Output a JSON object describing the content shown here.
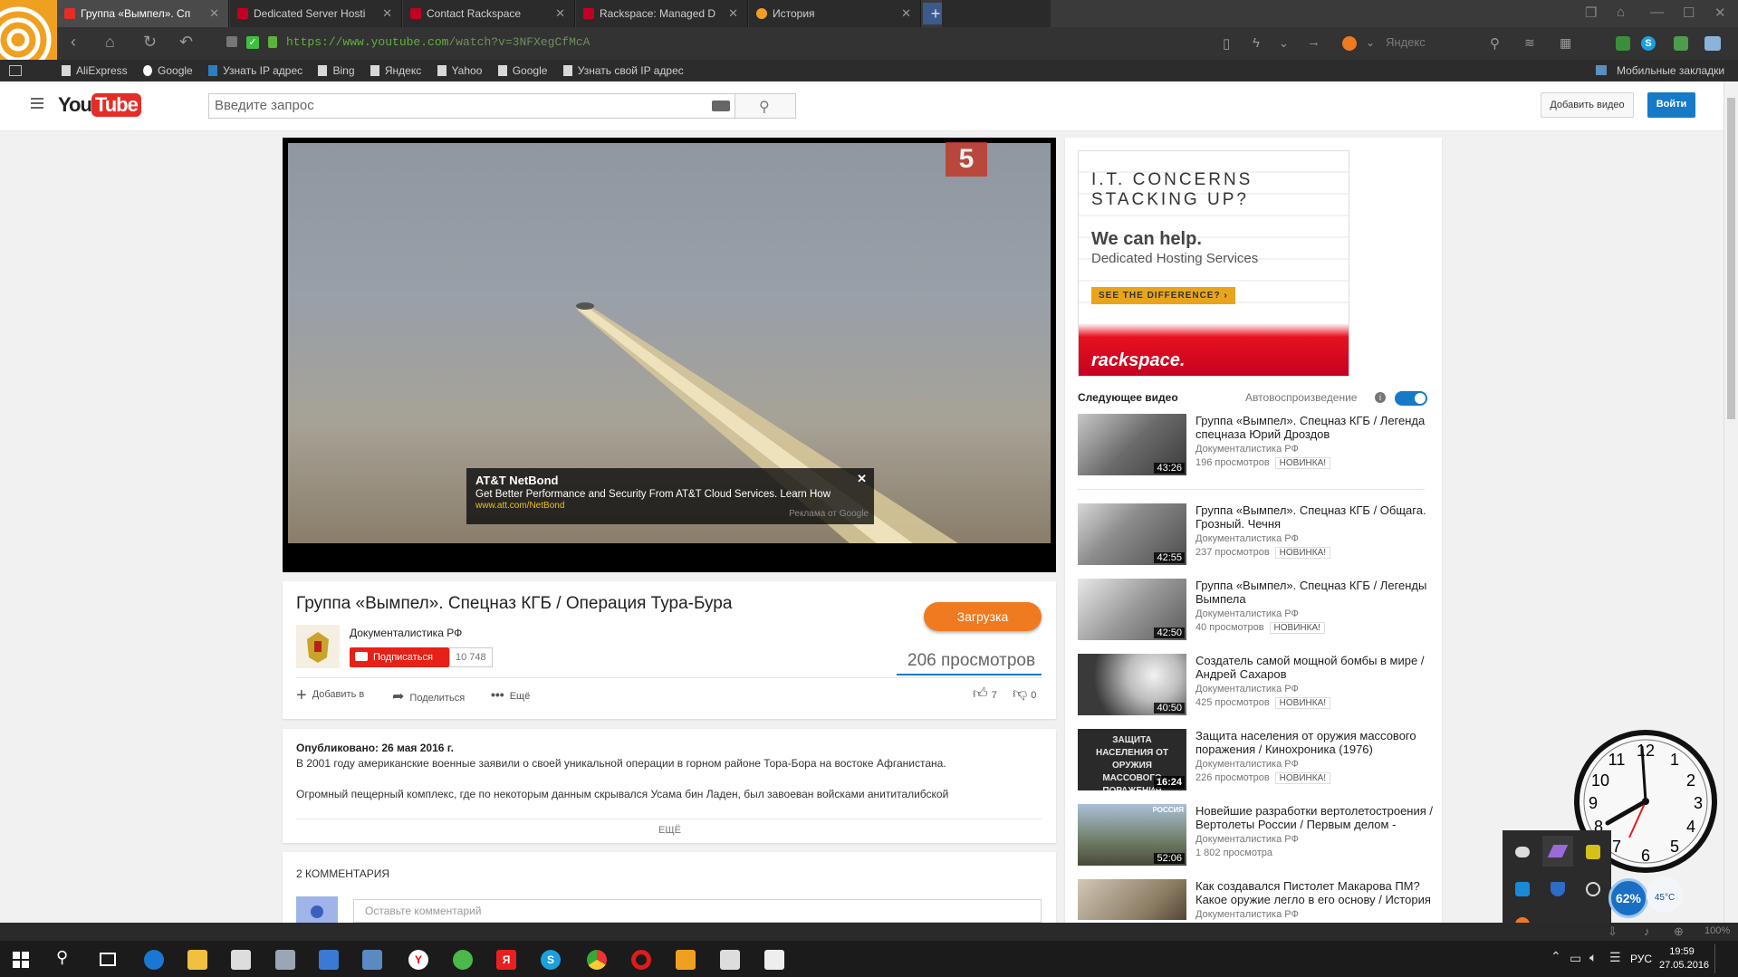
{
  "tabs": [
    {
      "label": "Группа «Вымпел». Сп",
      "active": true,
      "fav": "youtube-icon",
      "color": "#e52d27"
    },
    {
      "label": "Dedicated Server Hosti",
      "active": false,
      "fav": "rackspace-icon",
      "color": "#c40022"
    },
    {
      "label": "Contact Rackspace",
      "active": false,
      "fav": "rackspace-icon",
      "color": "#c40022"
    },
    {
      "label": "Rackspace: Managed D",
      "active": false,
      "fav": "rackspace-icon",
      "color": "#c40022"
    },
    {
      "label": "История",
      "active": false,
      "fav": "clock-icon",
      "color": "#f0a020"
    }
  ],
  "address": {
    "protocol": "https://",
    "host": "www.youtube.com",
    "path": "/watch?v=3NFXegCfMcA"
  },
  "search_engine": {
    "placeholder": "Яндекс"
  },
  "bookmarks": [
    "AliExpress",
    "Google",
    "Узнать IP адрес",
    "Bing",
    "Яндекс",
    "Yahoo",
    "Google",
    "Узнать свой IP адрес"
  ],
  "mobile_bookmarks": "Мобильные закладки",
  "youtube": {
    "logo_you": "You",
    "logo_tube": "Tube",
    "search_placeholder": "Введите запрос",
    "upload_label": "Добавить видео",
    "signin_label": "Войти"
  },
  "player": {
    "channel_badge": "5",
    "ad": {
      "title": "AT&T NetBond",
      "text": "Get Better Performance and Security From AT&T Cloud Services. Learn How",
      "url": "www.att.com/NetBond",
      "by": "Реклама от Google"
    }
  },
  "video": {
    "title": "Группа «Вымпел». Спецназ КГБ / Операция Тура-Бура",
    "channel": "Документалистика РФ",
    "subscribe_label": "Подписаться",
    "subscribers": "10 748",
    "download_label": "Загрузка",
    "views": "206 просмотров",
    "add_to": "Добавить в",
    "share": "Поделиться",
    "more": "Ещё",
    "likes": "7",
    "dislikes": "0",
    "published": "Опубликовано: 26 мая 2016 г.",
    "desc1": "В 2001 году американские военные заявили о своей уникальной операции в горном районе Тора-Бора на востоке Афганистана.",
    "desc2": "Огромный пещерный комплекс, где по некоторым данным скрывался Усама бин Ладен, был завоеван войсками анититалибской",
    "show_more": "ЕЩЁ",
    "comments_header": "2 КОММЕНТАРИЯ",
    "comment_placeholder": "Оставьте комментарий"
  },
  "banner": {
    "line1": "I.T. CONCERNS",
    "line2": "STACKING UP?",
    "help": "We can help.",
    "sub": "Dedicated Hosting Services",
    "cta": "SEE THE DIFFERENCE? ›",
    "brand": "rackspace."
  },
  "up_next": {
    "label": "Следующее видео",
    "autoplay": "Автовоспроизведение"
  },
  "related": [
    {
      "title": "Группа «Вымпел». Спецназ КГБ / Легенда спецназа Юрий Дроздов",
      "channel": "Документалистика РФ",
      "views": "196 просмотров",
      "badge": "НОВИНКА!",
      "duration": "43:26"
    },
    {
      "title": "Группа «Вымпел». Спецназ КГБ / Общага. Грозный. Чечня",
      "channel": "Документалистика РФ",
      "views": "237 просмотров",
      "badge": "НОВИНКА!",
      "duration": "42:55"
    },
    {
      "title": "Группа «Вымпел». Спецназ КГБ / Легенды Вымпела",
      "channel": "Документалистика РФ",
      "views": "40 просмотров",
      "badge": "НОВИНКА!",
      "duration": "42:50"
    },
    {
      "title": "Создатель самой мощной бомбы в мире / Андрей Сахаров",
      "channel": "Документалистика РФ",
      "views": "425 просмотров",
      "badge": "НОВИНКА!",
      "duration": "40:50"
    },
    {
      "title": "Защита населения от оружия массового поражения / Кинохроника (1976)",
      "channel": "Документалистика РФ",
      "views": "226 просмотров",
      "badge": "НОВИНКА!",
      "duration": "16:24",
      "thumb_text": "ЗАЩИТА НАСЕЛЕНИЯ ОТ ОРУЖИЯ МАССОВОГО ПОРАЖЕНИЯ"
    },
    {
      "title": "Новейшие разработки вертолетостроения / Вертолеты России / Первым делом -",
      "channel": "Документалистика РФ",
      "views": "1 802 просмотра",
      "badge": "",
      "duration": "52:06",
      "thumb_text": "РОССИЯ"
    },
    {
      "title": "Как создавался Пистолет Макарова ПМ? Какое оружие легло в его основу / История",
      "channel": "Документалистика РФ",
      "views": "",
      "badge": "",
      "duration": ""
    }
  ],
  "gadgets": {
    "cpu": "62%",
    "temp": "45°C",
    "zoom": "100%"
  },
  "taskbar": {
    "lang": "РУС",
    "time": "19:59",
    "date": "27.05.2016"
  }
}
